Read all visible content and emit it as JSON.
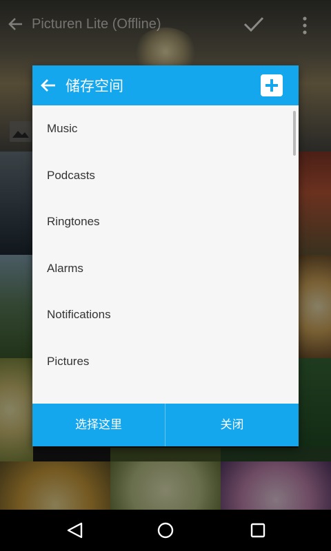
{
  "background_app": {
    "title": "Picturen Lite (Offline)",
    "icons": [
      "back-arrow-icon",
      "check-icon",
      "more-vert-icon",
      "image-icon"
    ]
  },
  "dialog": {
    "title": "储存空间",
    "back_icon": "back-arrow-icon",
    "add_icon": "add-icon",
    "items": [
      {
        "label": "Music"
      },
      {
        "label": "Podcasts"
      },
      {
        "label": "Ringtones"
      },
      {
        "label": "Alarms"
      },
      {
        "label": "Notifications"
      },
      {
        "label": "Pictures"
      }
    ],
    "select_here_label": "选择这里",
    "close_label": "关闭"
  },
  "nav": {
    "icons": [
      "nav-back-icon",
      "nav-home-icon",
      "nav-recents-icon"
    ]
  },
  "colors": {
    "accent": "#14a7ee",
    "dialog_bg": "#f6f6f6",
    "item_text": "#333333",
    "navbar_bg": "#000000"
  }
}
